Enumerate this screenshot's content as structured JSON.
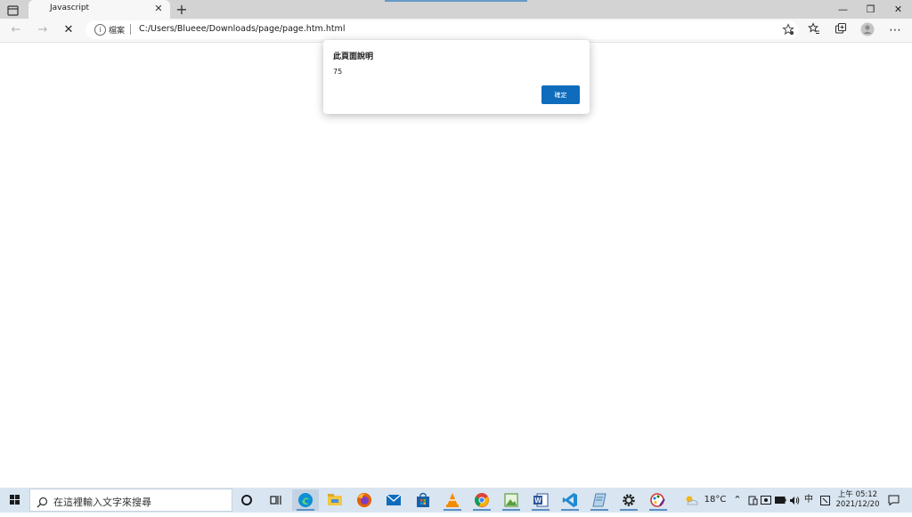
{
  "browser": {
    "tab": {
      "title": "Javascript",
      "close_glyph": "✕"
    },
    "new_tab_glyph": "+",
    "window_controls": {
      "minimize": "—",
      "restore": "❐",
      "close": "✕"
    },
    "nav": {
      "back": "←",
      "forward": "→",
      "stop": "✕"
    },
    "address": {
      "site_info_label": "檔案",
      "url": "C:/Users/Blueee/Downloads/page/page.htm.html"
    },
    "toolbar_icons": [
      "favorites-star-icon",
      "favorites-list-icon",
      "collections-icon",
      "profile-icon",
      "more-icon"
    ],
    "more_glyph": "⋯"
  },
  "dialog": {
    "title": "此頁面說明",
    "message": "75",
    "ok_label": "確定"
  },
  "taskbar": {
    "search_placeholder": "在這裡輸入文字來搜尋",
    "apps": [
      "cortana",
      "task-view",
      "edge",
      "file-explorer",
      "firefox",
      "mail",
      "store",
      "vlc",
      "chrome",
      "photos",
      "word",
      "vscode",
      "notepad",
      "settings",
      "paint"
    ],
    "weather_temp": "18°C",
    "ime": "中",
    "clock_time": "上午 05:12",
    "clock_date": "2021/12/20"
  },
  "colors": {
    "accent": "#0f6cbd",
    "tab_strip": "#d3d3d3",
    "taskbar": "#d9e5f0"
  }
}
